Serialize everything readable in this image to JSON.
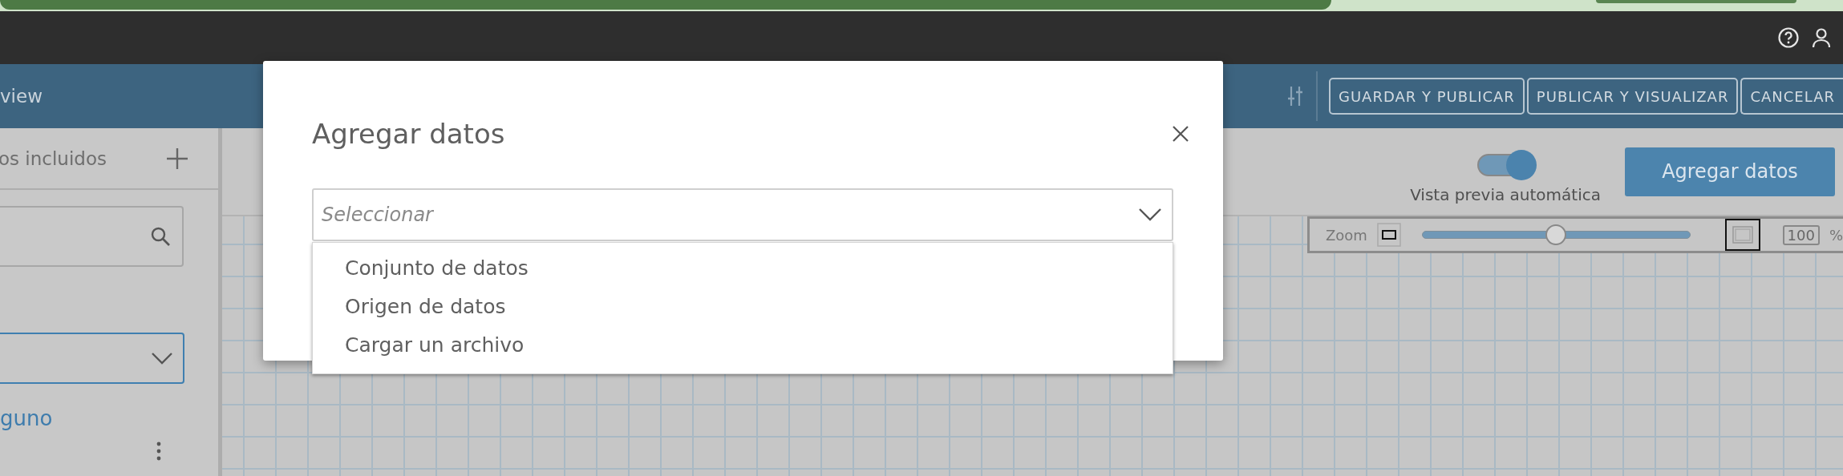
{
  "header": {
    "title_fragment": "view",
    "buttons": [
      "GUARDAR Y PUBLICAR",
      "PUBLICAR Y VISUALIZAR",
      "CANCELAR"
    ]
  },
  "sidebar": {
    "heading": "os incluidos",
    "link": "guno"
  },
  "canvas": {
    "auto_preview": {
      "label": "Vista previa automática",
      "on": true
    },
    "add_button": "Agregar datos",
    "zoom": {
      "label": "Zoom",
      "level": 0.5,
      "value": "100",
      "unit": "%"
    }
  },
  "dialog": {
    "title": "Agregar datos",
    "select": {
      "placeholder": "Seleccionar",
      "expanded": true,
      "options": [
        "Conjunto de datos",
        "Origen de datos",
        "Cargar un archivo"
      ]
    }
  }
}
